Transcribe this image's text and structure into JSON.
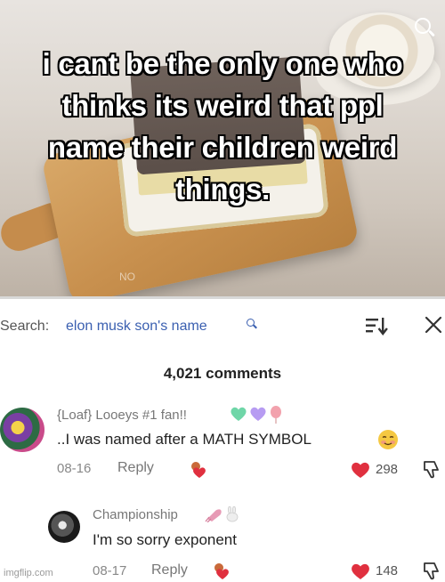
{
  "meme": {
    "caption_lines": [
      "i cant be the only one who",
      "thinks its weird that ppl",
      "name their children weird",
      "things."
    ],
    "watermark": "NO"
  },
  "search": {
    "label": "Search:",
    "query": "elon musk son's name"
  },
  "comments_header": "4,021 comments",
  "comments": [
    {
      "username": "{Loaf} Looeys #1 fan!!",
      "text": "..I was named after a MATH SYMBOL",
      "date": "08-16",
      "reply_label": "Reply",
      "likes": "298"
    },
    {
      "username": "Championship",
      "text": "I'm so sorry exponent",
      "date": "08-17",
      "reply_label": "Reply",
      "likes": "148"
    }
  ],
  "colors": {
    "like_red": "#e0303f",
    "search_blue": "#3a5fb0"
  },
  "icons": [
    "search-icon",
    "sort-icon",
    "close-icon",
    "heart-icon",
    "dislike-icon"
  ],
  "site_watermark": "imgflip.com"
}
